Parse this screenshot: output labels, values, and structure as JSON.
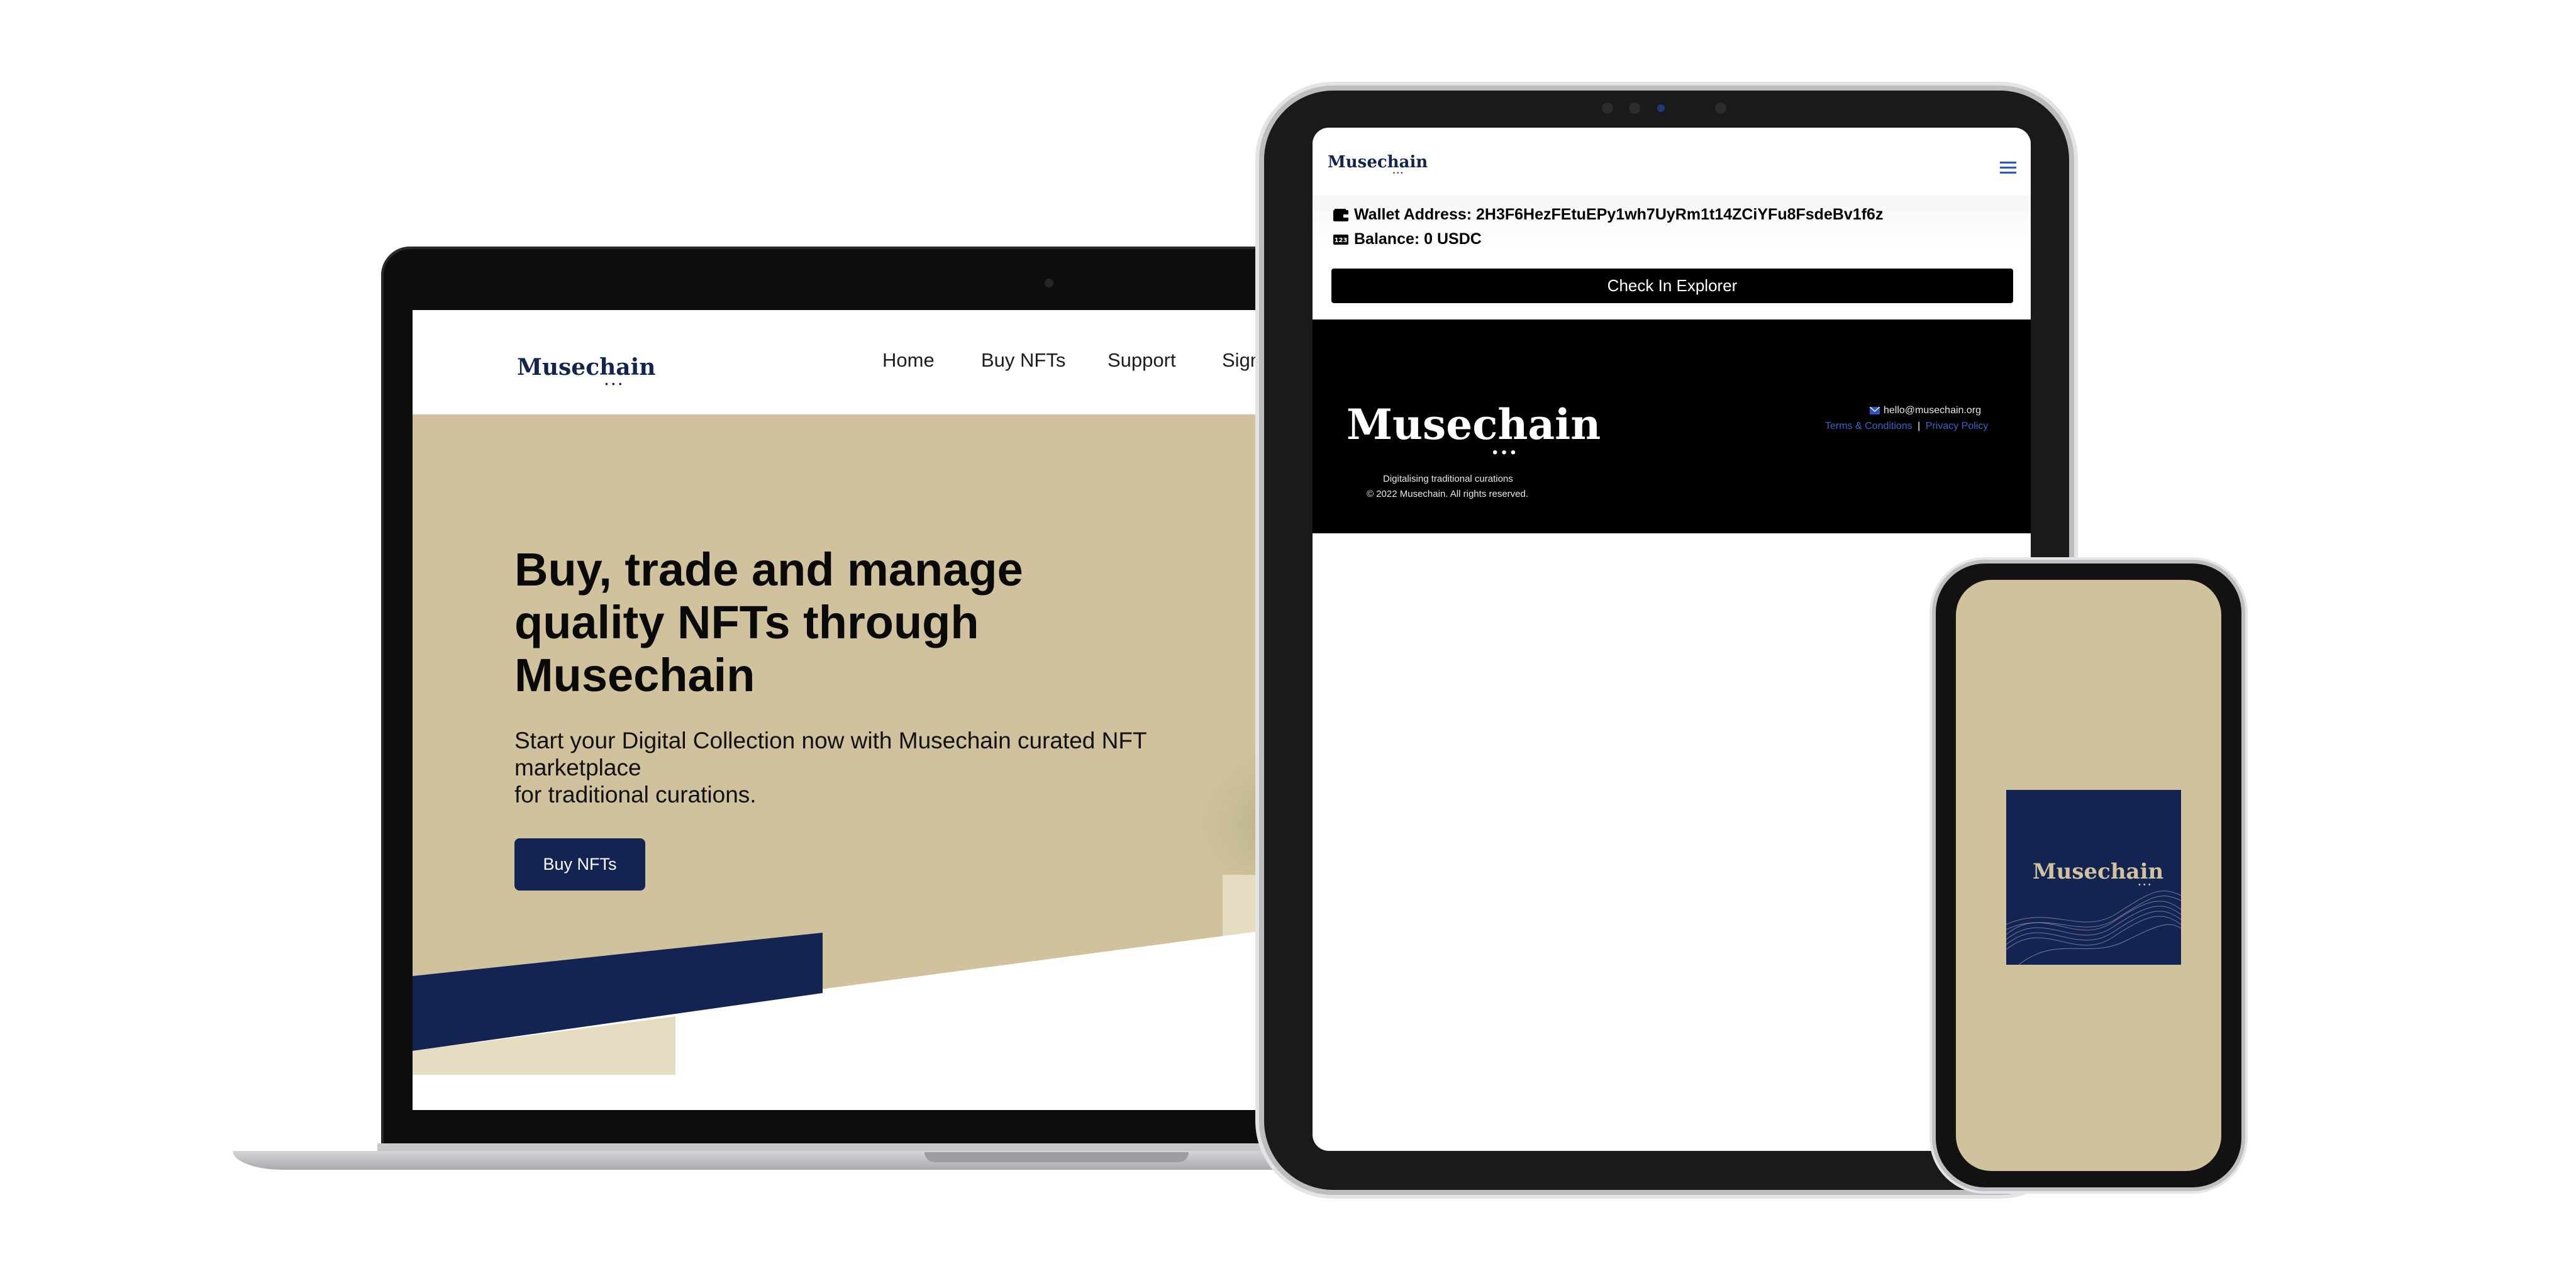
{
  "laptop": {
    "logo": "Musechain",
    "logo_dots": "•••",
    "nav": [
      "Home",
      "Buy NFTs",
      "Support",
      "Sign Up"
    ],
    "hero_title": "Buy, trade and manage quality NFTs through Musechain",
    "hero_subtitle": "Start your Digital Collection now with Musechain curated NFT marketplace\nfor traditional curations.",
    "hero_button": "Buy NFTs"
  },
  "tablet": {
    "logo": "Musechain",
    "logo_dots": "•••",
    "wallet_label": "Wallet Address: 2H3F6HezFEtuEPy1wh7UyRm1t14ZCiYFu8FsdeBv1f6z",
    "balance_label": "Balance: 0 USDC",
    "explorer_button": "Check In Explorer",
    "footer": {
      "logo": "Musechain",
      "logo_dots": "•••",
      "tagline": "Digitalising traditional curations",
      "copyright": "© 2022 Musechain. All rights reserved.",
      "email": "hello@musechain.org",
      "terms": "Terms & Conditions",
      "separator": "|",
      "privacy": "Privacy Policy"
    }
  },
  "phone": {
    "logo": "Musechain",
    "logo_dots": "•••"
  },
  "colors": {
    "navy": "#142452",
    "sand": "#cfc29c",
    "link_blue": "#3a63c8"
  }
}
